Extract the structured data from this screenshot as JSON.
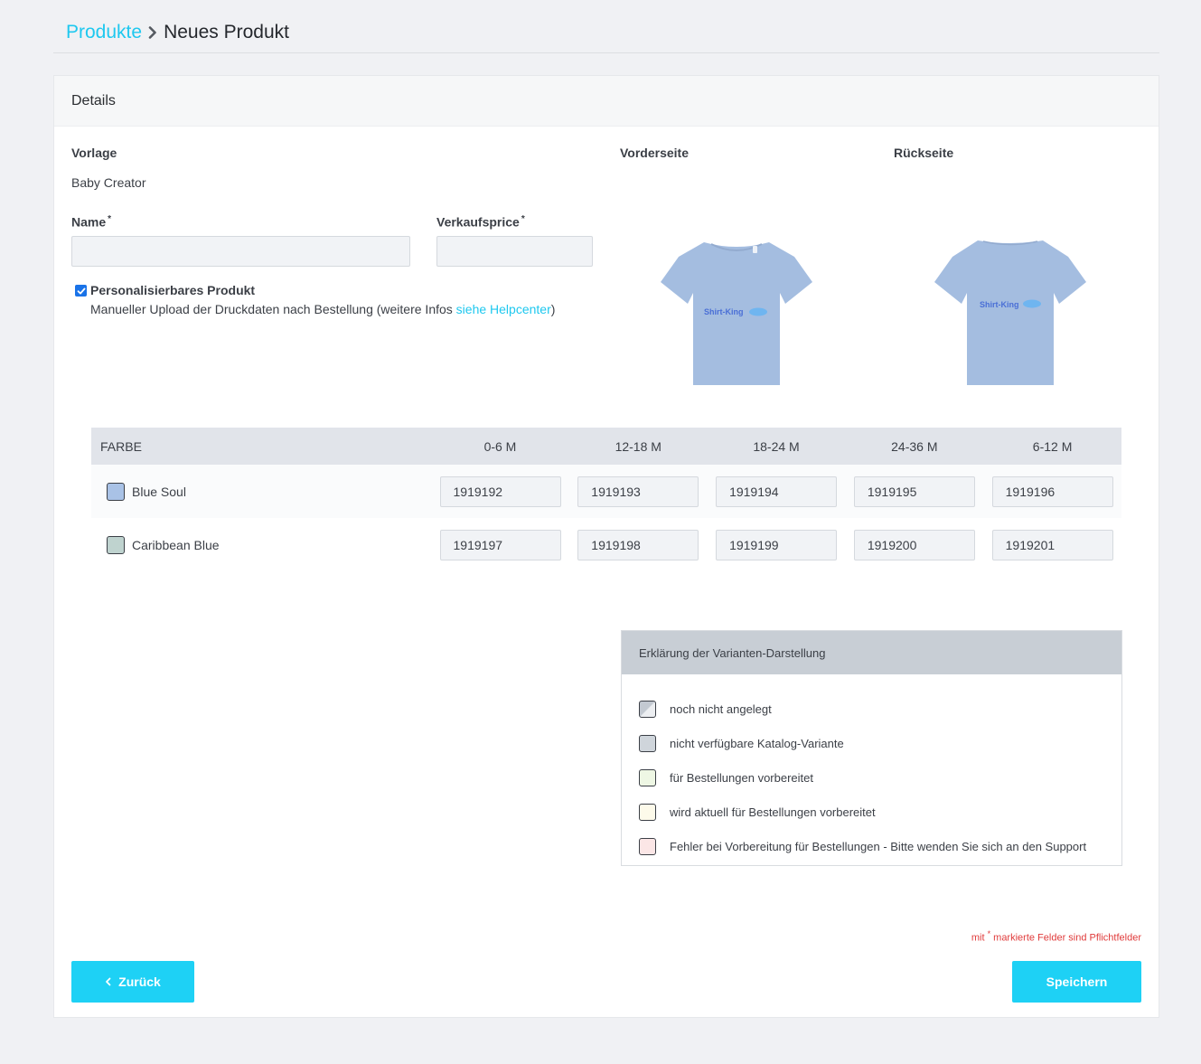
{
  "breadcrumb": {
    "parent": "Produkte",
    "current": "Neues Produkt"
  },
  "card": {
    "title": "Details"
  },
  "form": {
    "template_label": "Vorlage",
    "template_value": "Baby Creator",
    "name_label": "Name",
    "name_required": "*",
    "name_value": "",
    "price_label": "Verkaufsprice",
    "price_required": "*",
    "price_value": "",
    "personalizable_label": "Personalisierbares Produkt",
    "personalizable_checked": true,
    "personalizable_desc_before": "Manueller Upload der Druckdaten nach Bestellung (weitere Infos ",
    "personalizable_link": "siehe Helpcenter",
    "personalizable_desc_after": ")"
  },
  "preview": {
    "front_label": "Vorderseite",
    "back_label": "Rückseite",
    "shirt_color": "#a4bde0",
    "logo_text": "Shirt-King"
  },
  "variants": {
    "color_header": "FARBE",
    "sizes": [
      "0-6 M",
      "12-18 M",
      "18-24 M",
      "24-36 M",
      "6-12 M"
    ],
    "rows": [
      {
        "name": "Blue Soul",
        "swatch": "#a9c2e6",
        "skus": [
          "1919192",
          "1919193",
          "1919194",
          "1919195",
          "1919196"
        ]
      },
      {
        "name": "Caribbean Blue",
        "swatch": "#bfd3cf",
        "skus": [
          "1919197",
          "1919198",
          "1919199",
          "1919200",
          "1919201"
        ]
      }
    ]
  },
  "legend": {
    "title": "Erklärung der Varianten-Darstellung",
    "items": [
      {
        "label": "noch nicht angelegt",
        "color": "#e3e6ea"
      },
      {
        "label": "nicht verfügbare Katalog-Variante",
        "color": "#cfd5db"
      },
      {
        "label": "für Bestellungen vorbereitet",
        "color": "#eef7e4"
      },
      {
        "label": "wird aktuell für Bestellungen vorbereitet",
        "color": "#fdfaea"
      },
      {
        "label": "Fehler bei Vorbereitung für Bestellungen - Bitte wenden Sie sich an den Support",
        "color": "#fbe6e6"
      }
    ]
  },
  "footer": {
    "required_note_prefix": "mit",
    "required_note_star": "*",
    "required_note_suffix": "markierte Felder sind Pflichtfelder",
    "back_button": "Zurück",
    "save_button": "Speichern"
  },
  "colors": {
    "accent": "#1ec8ef",
    "button": "#1ed1f5",
    "error": "#e03b3b"
  }
}
